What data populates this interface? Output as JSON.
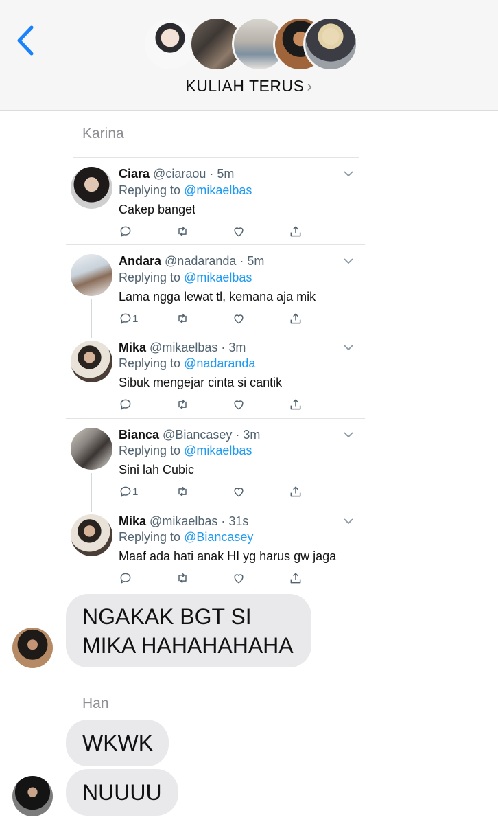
{
  "header": {
    "back_label": "Back",
    "group_name": "KULIAH TERUS",
    "chevron": "›",
    "avatar_count": 5
  },
  "messages": {
    "sender1": "Karina",
    "bubble1_line1": "NGAKAK BGT SI",
    "bubble1_line2": "MIKA HAHAHAHAHA",
    "sender2": "Han",
    "bubble2": "WKWK",
    "bubble3": "NUUUU"
  },
  "tweets": [
    {
      "name": "Ciara",
      "handle": "@ciaraou",
      "time": "· 5m",
      "replying_prefix": "Replying to",
      "replying_to": "@mikaelbas",
      "text": "Cakep banget",
      "reply_count": ""
    },
    {
      "name": "Andara",
      "handle": "@nadaranda",
      "time": "· 5m",
      "replying_prefix": "Replying to",
      "replying_to": "@mikaelbas",
      "text": "Lama ngga lewat tl, kemana aja mik",
      "reply_count": "1"
    },
    {
      "name": "Mika",
      "handle": "@mikaelbas",
      "time": "· 3m",
      "replying_prefix": "Replying to",
      "replying_to": "@nadaranda",
      "text": "Sibuk mengejar cinta si cantik",
      "reply_count": ""
    },
    {
      "name": "Bianca",
      "handle": "@Biancasey",
      "time": "· 3m",
      "replying_prefix": "Replying to",
      "replying_to": "@mikaelbas",
      "text": "Sini lah Cubic",
      "reply_count": "1"
    },
    {
      "name": "Mika",
      "handle": "@mikaelbas",
      "time": "· 31s",
      "replying_prefix": "Replying to",
      "replying_to": "@Biancasey",
      "text": "Maaf ada hati anak HI yg harus gw jaga",
      "reply_count": ""
    }
  ],
  "colors": {
    "ios_blue": "#1a82fb",
    "twitter_blue": "#1d9bf0",
    "bubble_gray": "#e9e9eb",
    "header_bg": "#f6f6f6"
  },
  "icons": [
    "chevron-left-icon",
    "chevron-right-icon",
    "reply-icon",
    "retweet-icon",
    "like-icon",
    "share-icon",
    "chevron-down-icon"
  ]
}
